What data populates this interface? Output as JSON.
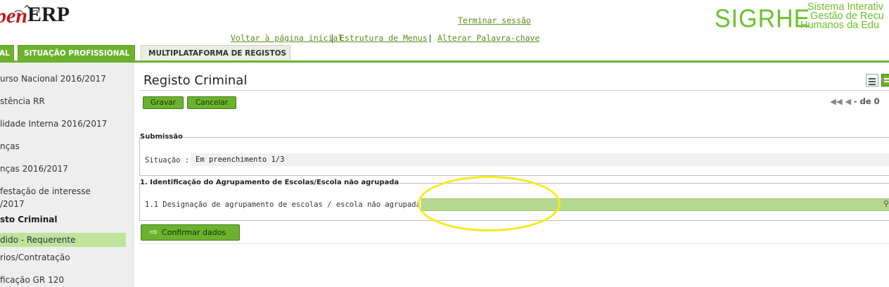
{
  "header": {
    "logo_pen": "pen",
    "logo_erp": "ERP",
    "brand_title": "SIGRHE",
    "brand_lines": [
      "Sistema Interativ",
      "Gestão de Recu",
      "Humanos da Edu"
    ],
    "links": {
      "logout": "Terminar sessão",
      "home": "Voltar à página inicial",
      "menus": "Estrutura de Menus",
      "password": "Alterar Palavra-chave"
    },
    "separator": "|"
  },
  "tabs": [
    {
      "label": "AL",
      "active": true
    },
    {
      "label": "SITUAÇÃO PROFISSIONAL",
      "active": true
    },
    {
      "label": "MULTIPLATAFORMA DE REGISTOS",
      "active": false
    }
  ],
  "sidebar": {
    "items": [
      {
        "label": "urso Nacional 2016/2017"
      },
      {
        "label": "stência RR"
      },
      {
        "label": "lidade Interna 2016/2017"
      },
      {
        "label": "nças"
      },
      {
        "label": "nças 2016/2017"
      },
      {
        "label": "festação de interesse"
      },
      {
        "label": "/2017"
      },
      {
        "label": "sto Criminal"
      },
      {
        "label": "dido - Requerente"
      },
      {
        "label": "rios/Contratação"
      },
      {
        "label": "ficação GR 120"
      }
    ]
  },
  "main": {
    "title": "Registo Criminal",
    "buttons": {
      "save": "Gravar",
      "cancel": "Cancelar",
      "confirm": "Confirmar dados"
    },
    "pager": {
      "text": "- de 0"
    },
    "submission": {
      "legend": "Submissão",
      "situation_label": "Situação :",
      "situation_value": "Em preenchimento 1/3"
    },
    "identification": {
      "legend": "1. Identificação do Agrupamento de Escolas/Escola não agrupada",
      "field_label": "1.1 Designação de agrupamento de escolas / escola não agrupada :",
      "field_value": ""
    }
  },
  "colors": {
    "accent_green": "#6cb22e",
    "light_green": "#b6d98f",
    "highlight_yellow": "#f4ea1a",
    "brand_red": "#c0171c"
  }
}
